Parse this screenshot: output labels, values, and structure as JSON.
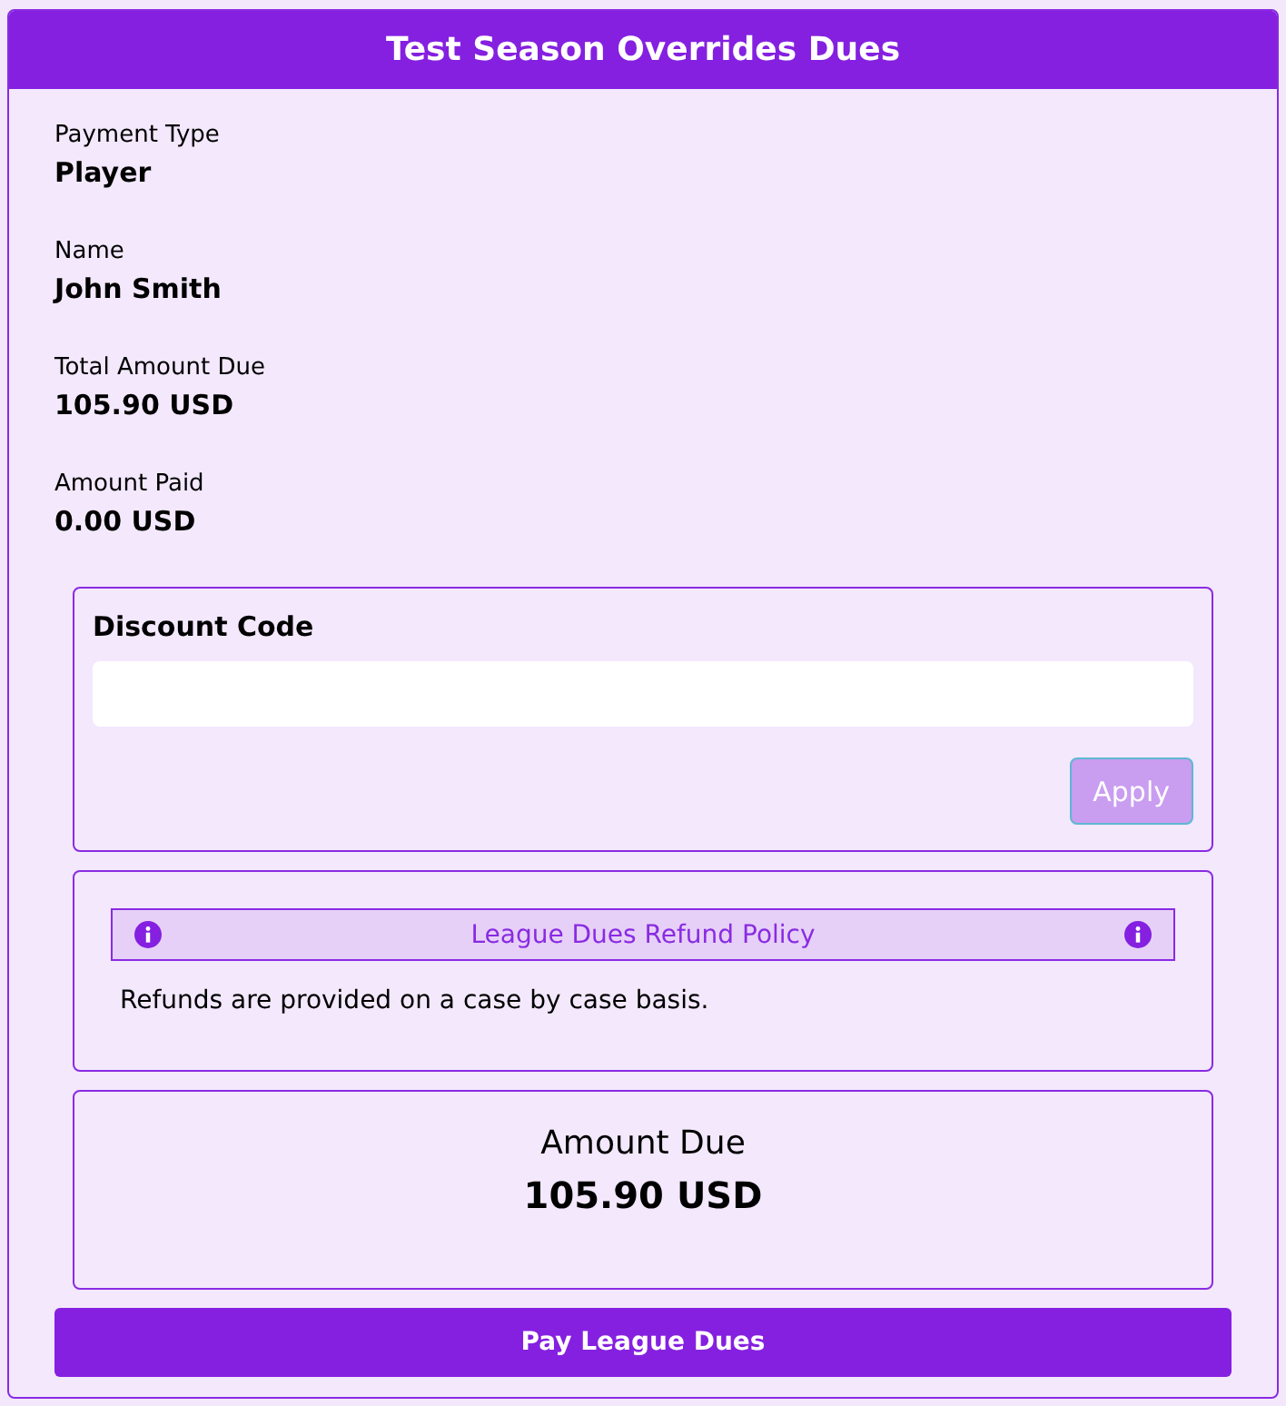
{
  "title": "Test Season Overrides Dues",
  "fields": [
    {
      "label": "Payment Type",
      "value": "Player"
    },
    {
      "label": "Name",
      "value": "John Smith"
    },
    {
      "label": "Total Amount Due",
      "value": "105.90 USD"
    },
    {
      "label": "Amount Paid",
      "value": "0.00 USD"
    }
  ],
  "discount": {
    "label": "Discount Code",
    "apply_button": {
      "label": "Apply",
      "disabled": true
    }
  },
  "refund_policy": {
    "title": "League Dues Refund Policy",
    "text": "Refunds are provided on a case by case basis."
  },
  "amount_due": {
    "label": "Amount Due",
    "value": "105.90 USD"
  },
  "pay_button": "Pay League Dues"
}
